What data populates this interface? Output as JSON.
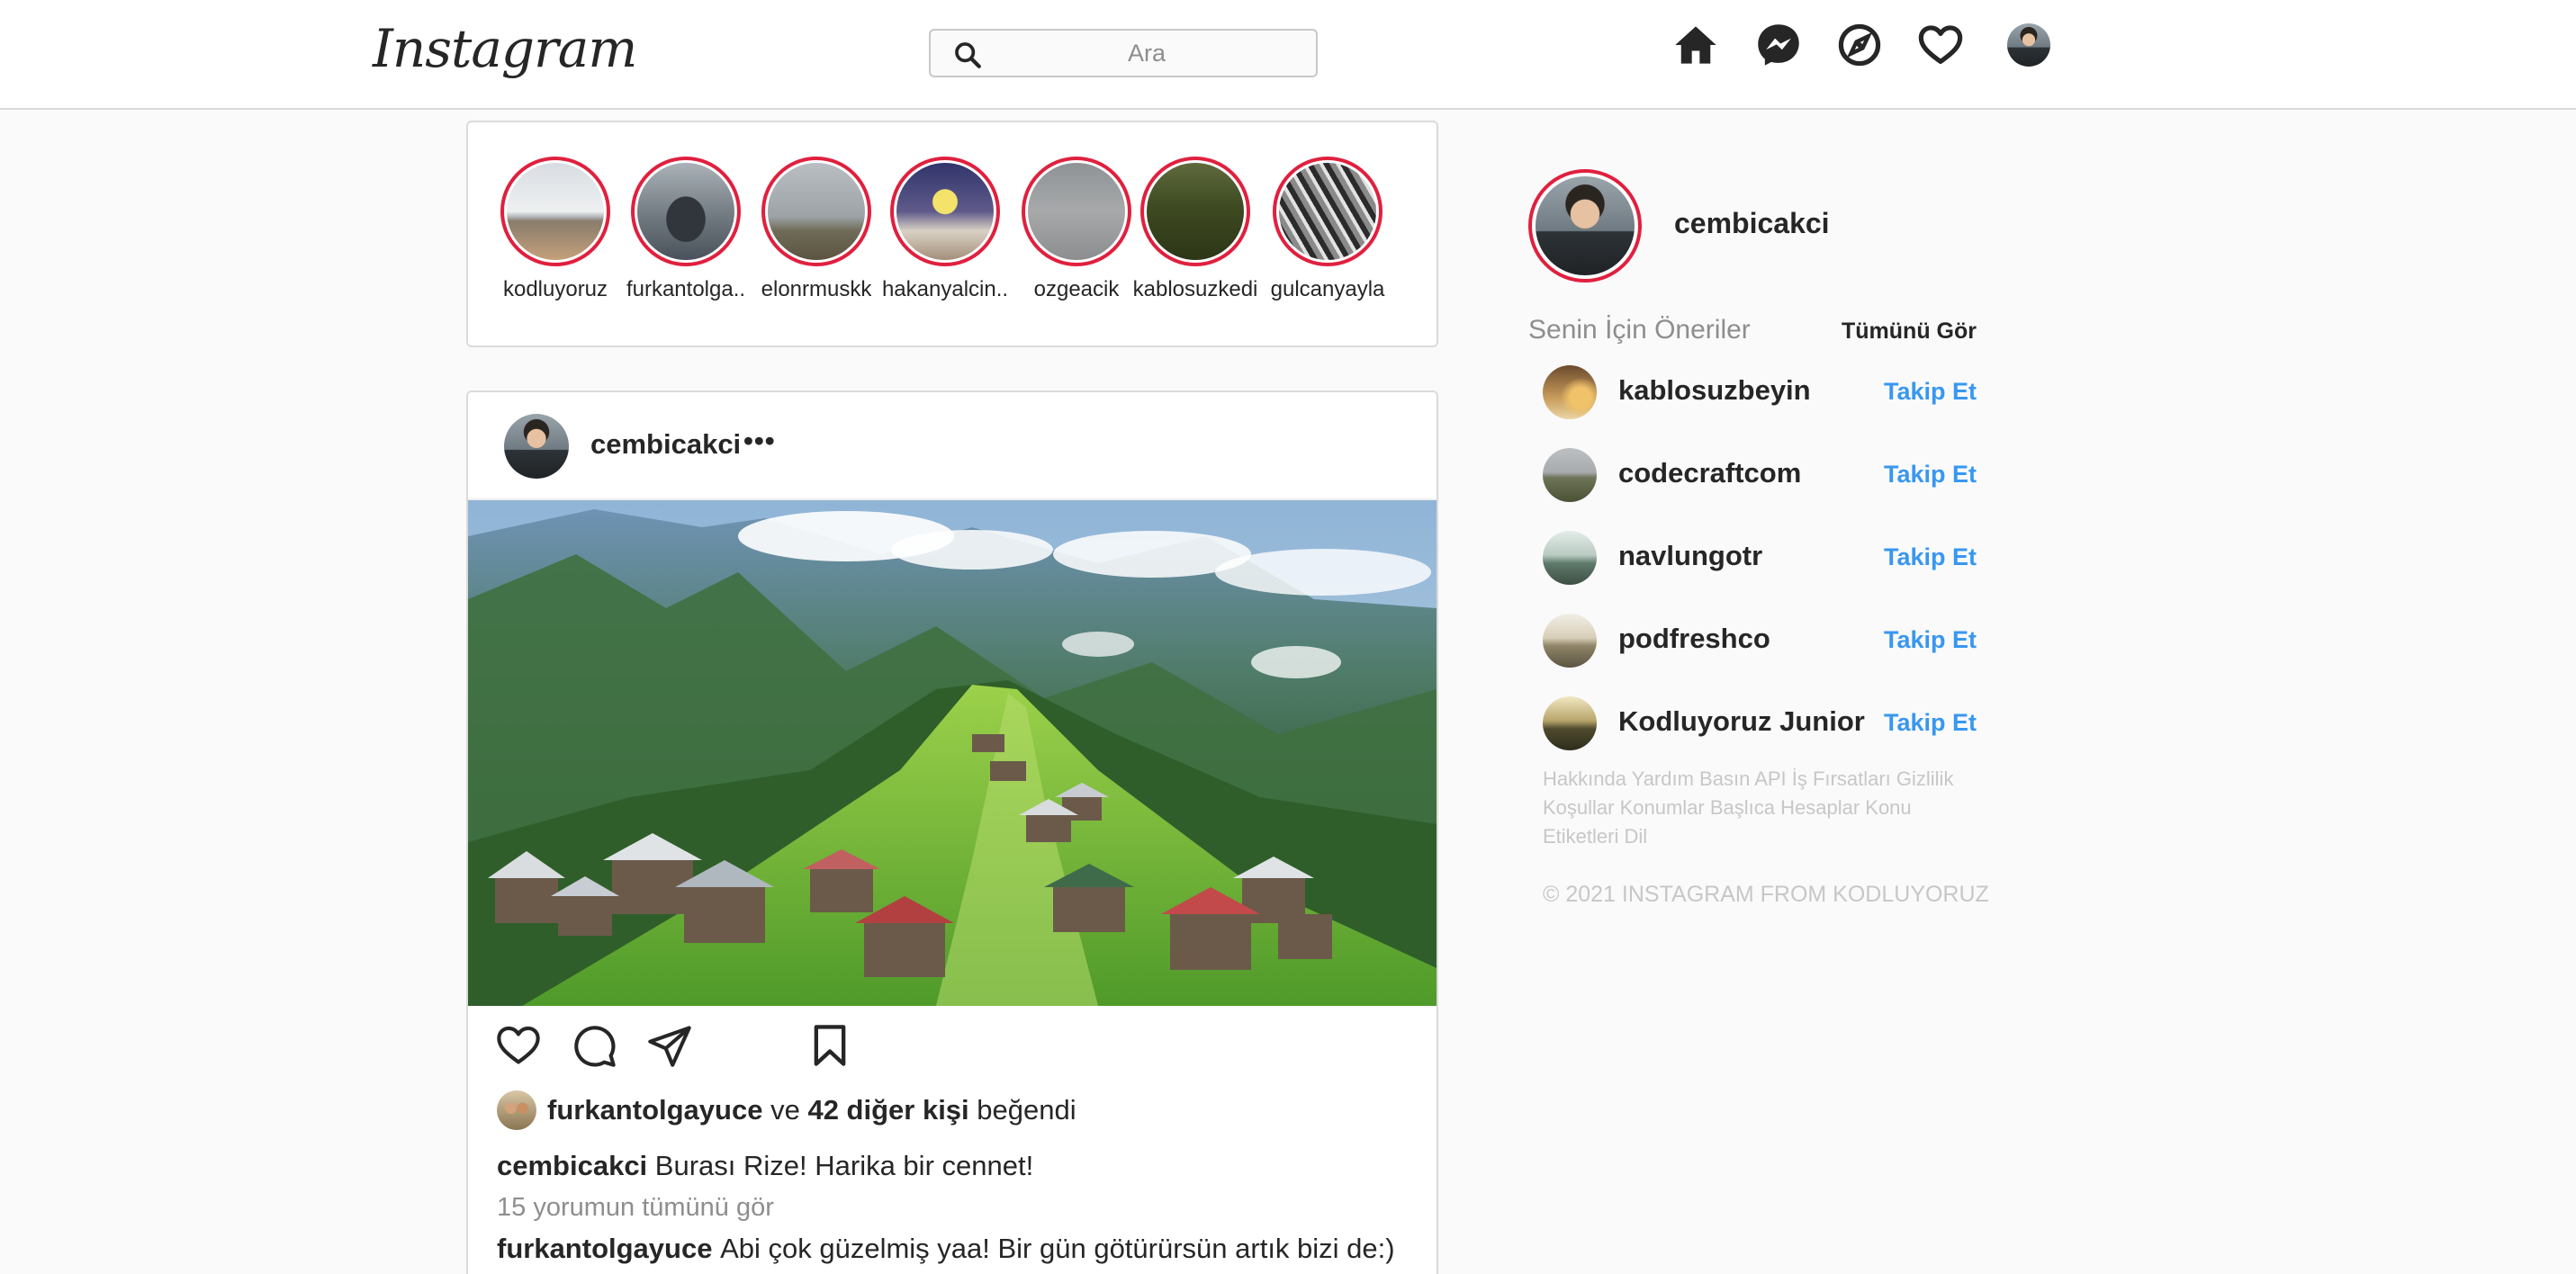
{
  "header": {
    "logo": "Instagram",
    "search_placeholder": "Ara",
    "icons": [
      "home-icon",
      "messenger-icon",
      "explore-icon",
      "heart-icon",
      "profile-avatar"
    ]
  },
  "stories": [
    {
      "username": "kodluyoruz"
    },
    {
      "username": "furkantolga.."
    },
    {
      "username": "elonrmuskk"
    },
    {
      "username": "hakanyalcin.."
    },
    {
      "username": "ozgeacik"
    },
    {
      "username": "kablosuzkedi"
    },
    {
      "username": "gulcanyayla"
    }
  ],
  "post": {
    "username": "cembicakci",
    "more": "•••",
    "likes": {
      "first_liker": "furkantolgayuce",
      "connector": "ve",
      "others": "42 diğer kişi",
      "suffix": "beğendi"
    },
    "caption": {
      "username": "cembicakci",
      "text": "Burası Rize! Harika bir cennet!"
    },
    "view_comments": "15 yorumun tümünü gör",
    "comment": {
      "username": "furkantolgayuce",
      "text": "Abi çok güzelmiş yaa! Bir gün götürürsün artık bizi de:)"
    }
  },
  "sidebar": {
    "username": "cembicakci",
    "suggestions_title": "Senin İçin Öneriler",
    "see_all": "Tümünü Gör",
    "suggestions": [
      {
        "username": "kablosuzbeyin",
        "action": "Takip Et"
      },
      {
        "username": "codecraftcom",
        "action": "Takip Et"
      },
      {
        "username": "navlungotr",
        "action": "Takip Et"
      },
      {
        "username": "podfreshco",
        "action": "Takip Et"
      },
      {
        "username": "Kodluyoruz Junior",
        "action": "Takip Et"
      }
    ],
    "footer_links": "Hakkında Yardım Basın API İş Fırsatları Gizlilik Koşullar Konumlar Başlıca Hesaplar Konu Etiketleri Dil",
    "copyright": "© 2021 INSTAGRAM FROM KODLUYORUZ"
  },
  "colors": {
    "story_ring": "#e0203e",
    "follow_link": "#3897f0",
    "muted_text": "#8e8e8e",
    "footer_text": "#c7c7c7"
  }
}
